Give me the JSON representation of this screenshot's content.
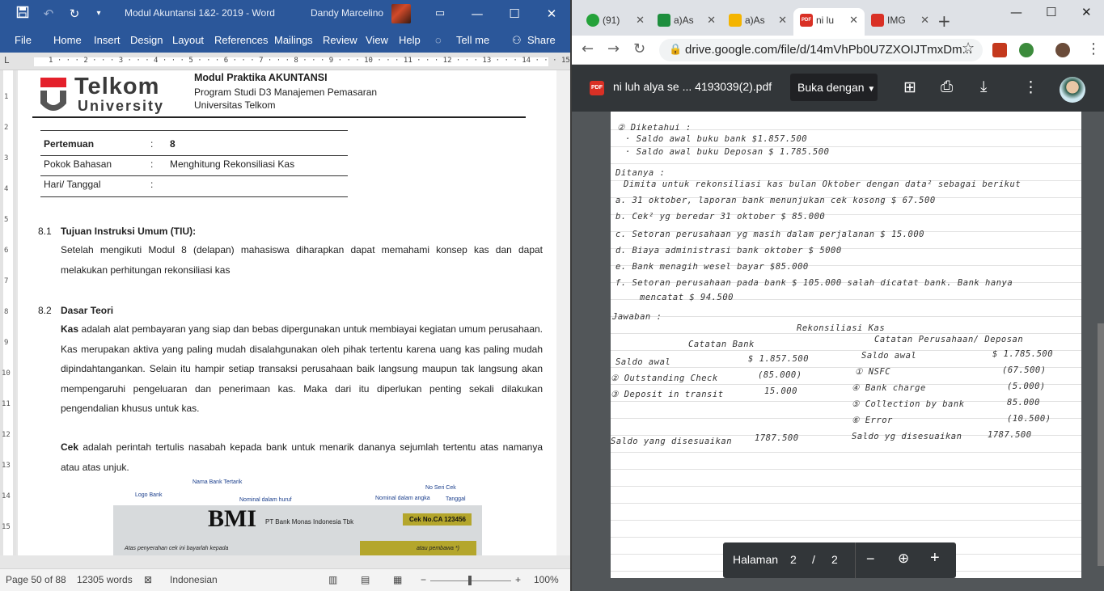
{
  "word": {
    "title": "Modul Akuntansi 1&2- 2019  -  Word",
    "user": "Dandy Marcelino",
    "menu": [
      "File",
      "Home",
      "Insert",
      "Design",
      "Layout",
      "References",
      "Mailings",
      "Review",
      "View",
      "Help",
      "Tell me",
      "Share"
    ],
    "ruler_numbers": "1 · · · 2 · · · 3 · · · 4 · · · 5 · · · 6 · · · 7 · · · 8 · · · 9 · · · 10 · · · 11 · · · 12 · · · 13 · · · 14 · · · 15 · · · 16 · ·",
    "vruler": [
      "1",
      "2",
      "3",
      "4",
      "5",
      "6",
      "7",
      "8",
      "9",
      "10",
      "11",
      "12",
      "13",
      "14",
      "15"
    ],
    "logo": {
      "line1": "Telkom",
      "line2": "University"
    },
    "header": {
      "title": "Modul Praktika AKUNTANSI",
      "line2": "Program Studi D3 Manajemen Pemasaran",
      "line3": "Universitas Telkom"
    },
    "table": [
      {
        "label": "Pertemuan",
        "sep": ":",
        "value": "8"
      },
      {
        "label": "Pokok Bahasan",
        "sep": ":",
        "value": "Menghitung Rekonsiliasi Kas"
      },
      {
        "label": "Hari/ Tanggal",
        "sep": ":",
        "value": ""
      }
    ],
    "sec1": {
      "num": "8.1",
      "title": "Tujuan Instruksi Umum (TIU):",
      "text": "Setelah mengikuti Modul 8 (delapan) mahasiswa diharapkan dapat memahami konsep kas dan dapat melakukan perhitungan rekonsiliasi kas"
    },
    "sec2": {
      "num": "8.2",
      "title": "Dasar Teori",
      "kas_bold": "Kas",
      "kas_text": " adalah alat pembayaran yang siap dan bebas dipergunakan untuk membiayai kegiatan umum perusahaan. Kas merupakan aktiva yang paling mudah disalahgunakan oleh pihak tertentu karena uang kas paling mudah dipindahtangankan. Selain itu hampir setiap transaksi perusahaan baik langsung maupun tak langsung akan mempengaruhi pengeluaran dan penerimaan kas. Maka dari itu diperlukan penting sekali dilakukan pengendalian khusus untuk kas.",
      "cek_bold": "Cek",
      "cek_text": " adalah perintah tertulis nasabah kepada bank untuk menarik dananya sejumlah tertentu atas namanya atau atas unjuk."
    },
    "cek": {
      "nama_bank": "Nama Bank Tertarik",
      "logo_bank": "Logo Bank",
      "nominal_huruf": "Nominal dalam huruf",
      "no_seri": "No Seri Cek",
      "nominal_angka": "Nominal dalam angka",
      "tanggal": "Tanggal",
      "bmi": "BMI",
      "bank_name": "PT Bank Monas Indonesia Tbk",
      "cek_no": "Cek No.CA  123456",
      "atas": "Atas penyerahan cek ini bayarlah kepada",
      "pembawa": "atau pembawa *)"
    },
    "status": {
      "page": "Page 50 of 88",
      "words": "12305 words",
      "lang": "Indonesian",
      "zoom": "100%"
    }
  },
  "chrome": {
    "tabs": [
      {
        "label": "(91)",
        "color": "#25a23a",
        "active": false
      },
      {
        "label": "a)As",
        "color": "#1e8e3e",
        "active": false
      },
      {
        "label": "a)As",
        "color": "#f4b400",
        "active": false
      },
      {
        "label": "ni lu",
        "color": "#d93025",
        "active": true
      },
      {
        "label": "IMG",
        "color": "#d93025",
        "active": false
      }
    ],
    "url": "drive.google.com/file/d/14mVhPb0U7ZXOIJTmxDm...",
    "viewer": {
      "filename": "ni luh alya se ... 4193039(2).pdf",
      "open_with": "Buka dengan",
      "page_label": "Halaman",
      "page_current": "2",
      "page_sep": "/",
      "page_total": "2"
    },
    "handwriting": [
      "② Diketahui :",
      "· Saldo awal buku bank $1.857.500",
      "· Saldo awal buku Deposan $ 1.785.500",
      "Ditanya :",
      "Dimita untuk rekonsiliasi kas bulan Oktober dengan data² sebagai berikut",
      "a. 31 oktober, laporan bank menunjukan cek kosong  $ 67.500",
      "b. Cek² yg beredar 31 oktober  $ 85.000",
      "c. Setoran perusahaan yg masih dalam perjalanan  $ 15.000",
      "d. Biaya administrasi bank oktober  $ 5000",
      "e. Bank menagih wesel bayar $85.000",
      "f. Setoran perusahaan pada bank $ 105.000 salah dicatat bank. Bank hanya",
      "mencatat $ 94.500",
      "Jawaban :",
      "Rekonsiliasi Kas",
      "Catatan Bank",
      "Catatan Perusahaan/ Deposan",
      "Saldo awal",
      "$ 1.857.500",
      "Saldo awal",
      "$ 1.785.500",
      "② Outstanding Check",
      "(85.000)",
      "① NSFC",
      "(67.500)",
      "③ Deposit in transit",
      "15.000",
      "④ Bank charge",
      "(5.000)",
      "⑤ Collection by bank",
      "85.000",
      "⑥ Error",
      "(10.500)",
      "Saldo yang disesuaikan",
      "1787.500",
      "Saldo yg disesuaikan",
      "1787.500"
    ]
  }
}
